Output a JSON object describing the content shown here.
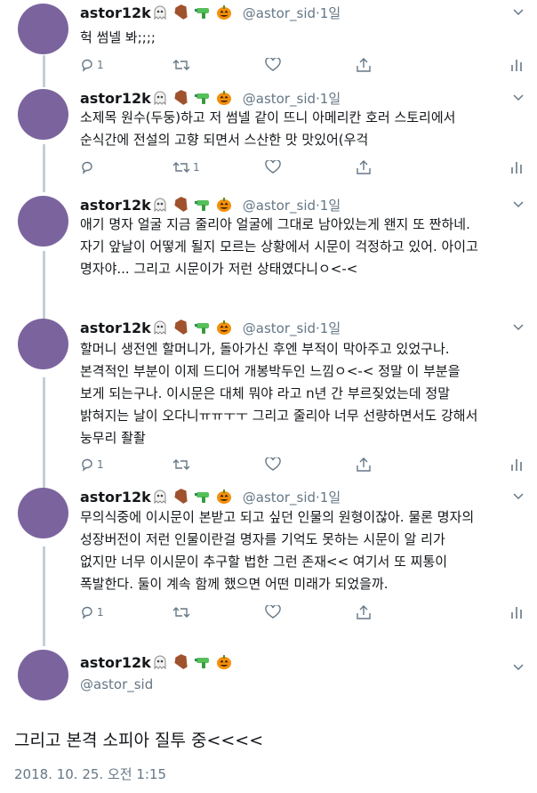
{
  "thread": [
    {
      "name": "astor12k",
      "handle": "@astor_sid",
      "sep": "·",
      "time": "1일",
      "text": "헉 썸넬 봐;;;;",
      "reply_count": "1",
      "retweet_count": "",
      "like_count": ""
    },
    {
      "name": "astor12k",
      "handle": "@astor_sid",
      "sep": "·",
      "time": "1일",
      "text": "소제목 원수(두둥)하고 저 썸넬 같이 뜨니 아메리칸 호러 스토리에서\n순식간에 전설의 고향 되면서 스산한 맛 맛있어(우걱",
      "reply_count": "",
      "retweet_count": "1",
      "like_count": ""
    },
    {
      "name": "astor12k",
      "handle": "@astor_sid",
      "sep": "·",
      "time": "1일",
      "text": "애기 명자 얼굴 지금 줄리아 얼굴에 그대로 남아있는게 왠지 또 짠하네.\n자기 앞날이 어떻게 될지 모르는 상황에서 시문이 걱정하고 있어. 아이고\n명자야... 그리고 시문이가 저런 상태였다니ㅇ<-<",
      "reply_count": "",
      "retweet_count": "",
      "like_count": ""
    },
    {
      "name": "astor12k",
      "handle": "@astor_sid",
      "sep": "·",
      "time": "1일",
      "text": "할머니 생전엔 할머니가, 돌아가신 후엔 부적이 막아주고 있었구나.\n본격적인 부분이 이제 드디어 개봉박두인 느낌ㅇ<-< 정말 이 부분을\n보게 되는구나. 이시문은 대체 뭐야 라고 n년 간 부르짖었는데 정말\n밝혀지는 날이 오다니ㅠㅠㅜㅜ 그리고 줄리아 너무 선량하면서도 강해서\n눙무리 좔좔",
      "reply_count": "1",
      "retweet_count": "",
      "like_count": ""
    },
    {
      "name": "astor12k",
      "handle": "@astor_sid",
      "sep": "·",
      "time": "1일",
      "text": "무의식중에 이시문이 본받고 되고 싶던 인물의 원형이잖아. 물론 명자의\n성장버전이 저런 인물이란걸 명자를 기억도 못하는 시문이 알 리가\n없지만 너무 이시문이 추구할 법한 그런 존재<< 여기서 또 찌통이\n폭발한다. 둘이 계속 함께 했으면 어떤 미래가 되었을까.",
      "reply_count": "1",
      "retweet_count": "",
      "like_count": ""
    }
  ],
  "main": {
    "name": "astor12k",
    "handle": "@astor_sid",
    "text": "그리고 본격 소피아 질투 중<<<<",
    "timestamp": "2018. 10. 25. 오전 1:15"
  },
  "colors": {
    "avatar": "#7b649e",
    "thread_line": "#c4cfd6",
    "secondary": "#657786"
  },
  "icons": [
    "ghost-icon",
    "coffin-icon",
    "water-pistol-icon",
    "pumpkin-icon",
    "reply-icon",
    "retweet-icon",
    "like-icon",
    "share-icon",
    "analytics-icon",
    "chevron-down-icon"
  ]
}
